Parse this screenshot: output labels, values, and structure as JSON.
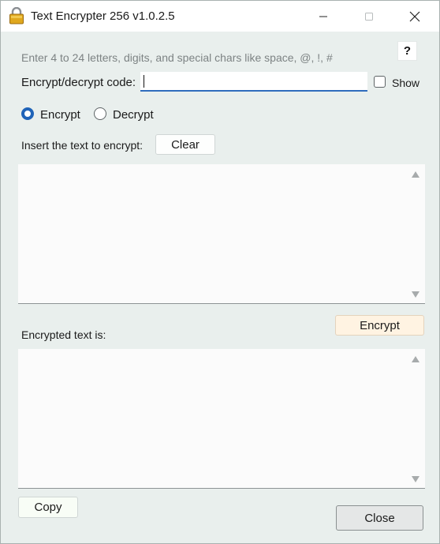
{
  "window": {
    "title": "Text Encrypter 256 v1.0.2.5",
    "icon": "padlock-icon"
  },
  "hint": "Enter 4 to 24 letters, digits, and special chars like space, @, !,  #",
  "help_label": "?",
  "code": {
    "label": "Encrypt/decrypt code:",
    "value": "",
    "show_label": "Show",
    "show_checked": false
  },
  "mode": {
    "encrypt_label": "Encrypt",
    "decrypt_label": "Decrypt",
    "selected": "Encrypt"
  },
  "input": {
    "label": "Insert the text to encrypt:",
    "clear_label": "Clear",
    "value": ""
  },
  "action": {
    "encrypt_label": "Encrypt"
  },
  "output": {
    "label": "Encrypted text is:",
    "value": ""
  },
  "footer": {
    "copy_label": "Copy",
    "close_label": "Close"
  },
  "colors": {
    "accent": "#1f63b8",
    "background": "#e9efed",
    "encrypt_button": "#fff3e2"
  }
}
